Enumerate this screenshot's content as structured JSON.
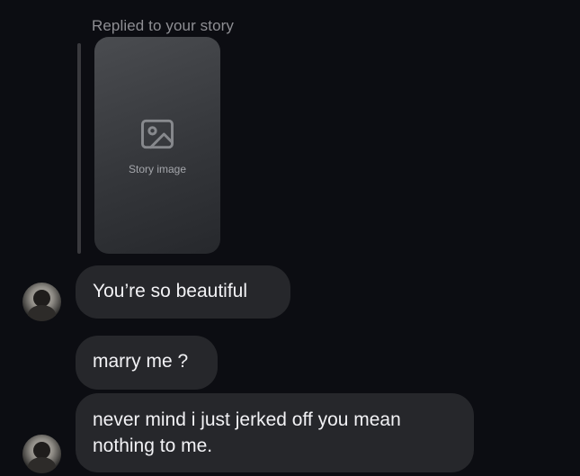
{
  "thread": {
    "reply_label": "Replied to your story",
    "story_placeholder": "Story image",
    "messages": [
      {
        "text": "You’re so beautiful"
      },
      {
        "text": "marry me ?"
      },
      {
        "text": "never mind i just jerked off you mean nothing to me."
      }
    ]
  },
  "colors": {
    "background": "#0c0d12",
    "bubble": "#26272b",
    "meta_text": "#8e8e93"
  },
  "icons": {
    "story_placeholder": "image-icon"
  }
}
